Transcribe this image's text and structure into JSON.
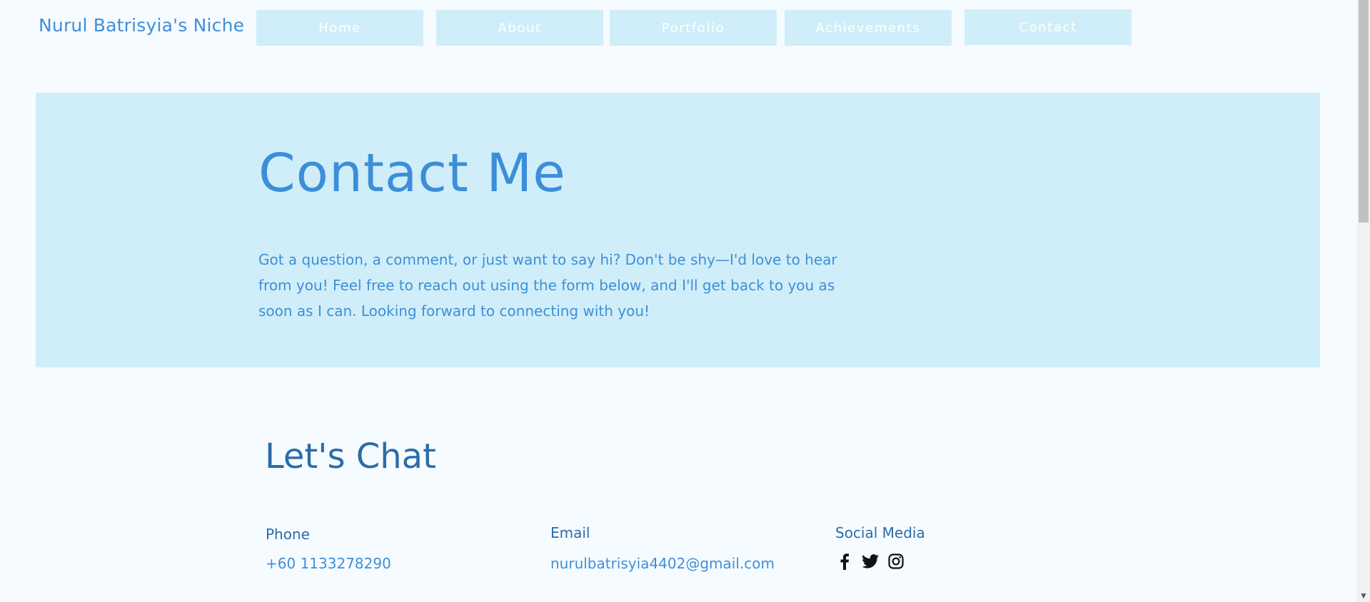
{
  "header": {
    "site_title": "Nurul Batrisyia's Niche",
    "nav": [
      {
        "label": "Home"
      },
      {
        "label": "About"
      },
      {
        "label": "Portfolio"
      },
      {
        "label": "Achievements"
      },
      {
        "label": "Contact"
      }
    ]
  },
  "hero": {
    "title": "Contact Me",
    "text": "Got a question, a comment, or just want to say hi? Don't be shy—I'd love to hear from you! Feel free to reach out using the form below, and I'll get back to you as soon as I can. Looking forward to connecting with you!"
  },
  "chat": {
    "title": "Let's Chat",
    "phone_label": "Phone",
    "phone_value": "+60 1133278290",
    "email_label": "Email",
    "email_value": "nurulbatrisyia4402@gmail.com",
    "social_label": "Social Media",
    "social_icons": [
      "facebook-icon",
      "twitter-icon",
      "instagram-icon"
    ]
  },
  "colors": {
    "background": "#f6fbff",
    "accent_light": "#cfeef9",
    "accent": "#3f8fd8",
    "heading_dark": "#2b6ca9"
  }
}
